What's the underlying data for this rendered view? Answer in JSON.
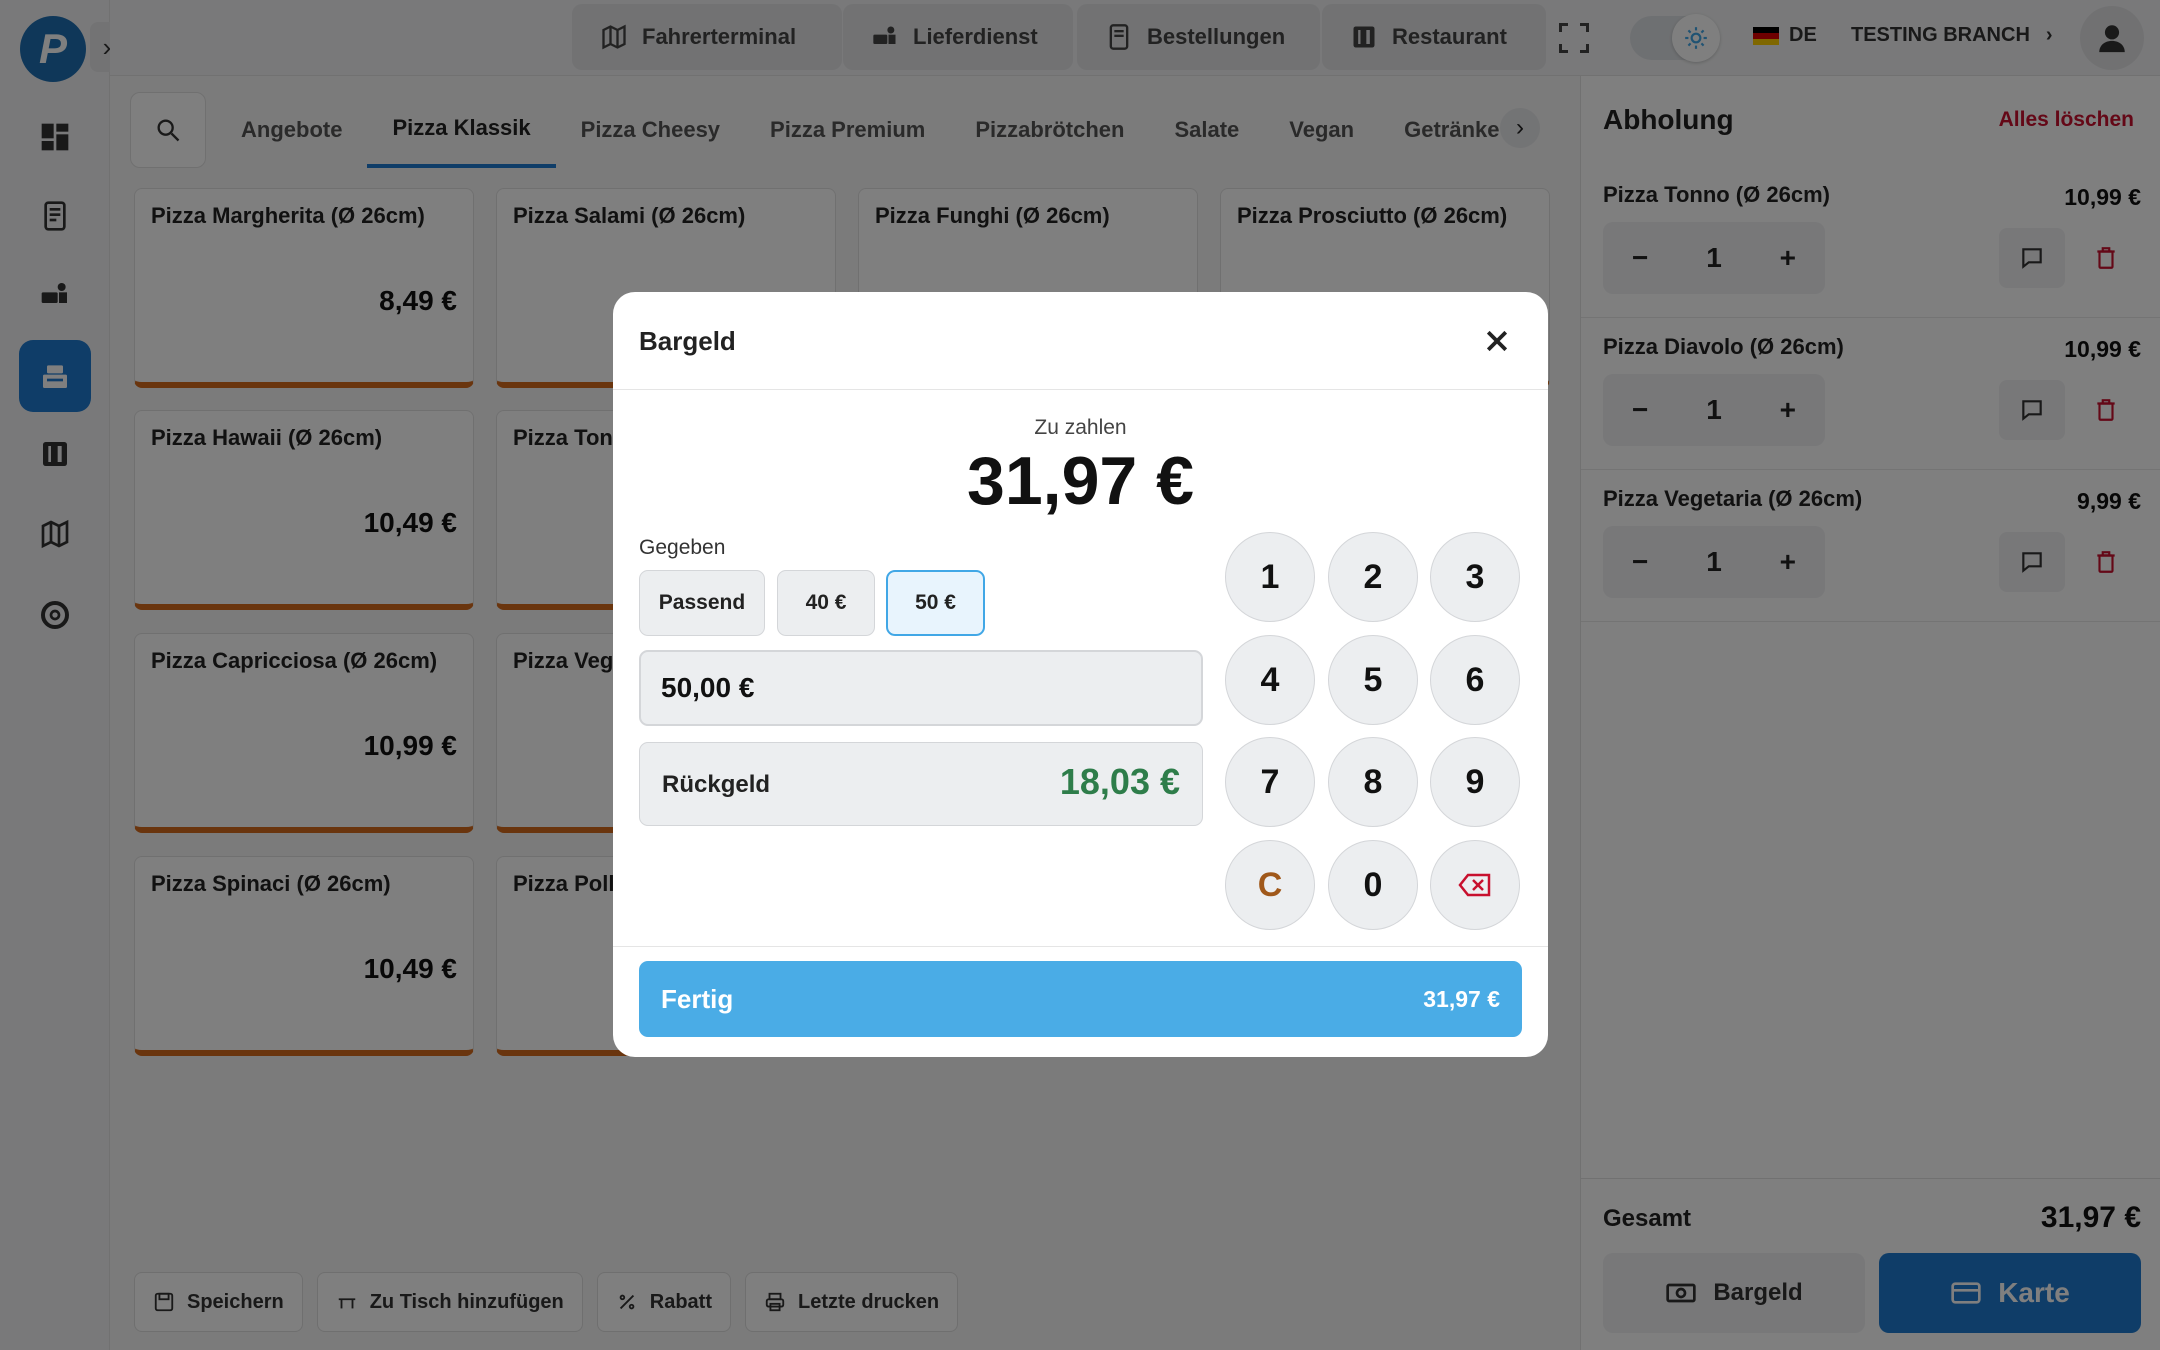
{
  "topbar": {
    "buttons": [
      {
        "label": "Fahrerterminal",
        "icon": "map-icon"
      },
      {
        "label": "Lieferdienst",
        "icon": "delivery-icon"
      },
      {
        "label": "Bestellungen",
        "icon": "receipt-icon"
      },
      {
        "label": "Restaurant",
        "icon": "cutlery-icon"
      }
    ],
    "language": "DE",
    "branch": "TESTING BRANCH"
  },
  "categories": {
    "tabs": [
      "Angebote",
      "Pizza Klassik",
      "Pizza Cheesy",
      "Pizza Premium",
      "Pizzabrötchen",
      "Salate",
      "Vegan",
      "Getränke"
    ],
    "active": "Pizza Klassik"
  },
  "products": [
    {
      "name": "Pizza Margherita (Ø 26cm)",
      "price": "8,49 €"
    },
    {
      "name": "Pizza Salami (Ø 26cm)",
      "price": ""
    },
    {
      "name": "Pizza Funghi (Ø 26cm)",
      "price": ""
    },
    {
      "name": "Pizza Prosciutto (Ø 26cm)",
      "price": ""
    },
    {
      "name": "Pizza Hawaii (Ø 26cm)",
      "price": "10,49 €"
    },
    {
      "name": "Pizza Tonn",
      "price": ""
    },
    {
      "name": "Pizza Capricciosa (Ø 26cm)",
      "price": "10,99 €"
    },
    {
      "name": "Pizza Vege",
      "price": ""
    },
    {
      "name": "Pizza Spinaci (Ø 26cm)",
      "price": "10,49 €"
    },
    {
      "name": "Pizza Poll",
      "price": ""
    }
  ],
  "bottom_actions": [
    "Speichern",
    "Zu Tisch hinzufügen",
    "Rabatt",
    "Letzte drucken"
  ],
  "cart": {
    "title": "Abholung",
    "clear_label": "Alles löschen",
    "items": [
      {
        "name": "Pizza Tonno (Ø 26cm)",
        "price": "10,99 €",
        "qty": "1"
      },
      {
        "name": "Pizza Diavolo (Ø 26cm)",
        "price": "10,99 €",
        "qty": "1"
      },
      {
        "name": "Pizza Vegetaria (Ø 26cm)",
        "price": "9,99 €",
        "qty": "1"
      }
    ],
    "total_label": "Gesamt",
    "total": "31,97 €",
    "cash_label": "Bargeld",
    "card_label": "Karte"
  },
  "modal": {
    "title": "Bargeld",
    "due_label": "Zu zahlen",
    "due": "31,97 €",
    "given_label": "Gegeben",
    "quick_options": [
      "Passend",
      "40 €",
      "50 €"
    ],
    "selected_quick": "50 €",
    "given_value": "50,00 €",
    "change_label": "Rückgeld",
    "change_value": "18,03 €",
    "keys": [
      "1",
      "2",
      "3",
      "4",
      "5",
      "6",
      "7",
      "8",
      "9",
      "C",
      "0"
    ],
    "done_label": "Fertig",
    "done_amount": "31,97 €"
  },
  "colors": {
    "accent": "#1e7ad0",
    "done_button": "#4aace6",
    "change_green": "#2e7d4a",
    "danger": "#c8102e",
    "card_border": "#d46a1c"
  }
}
